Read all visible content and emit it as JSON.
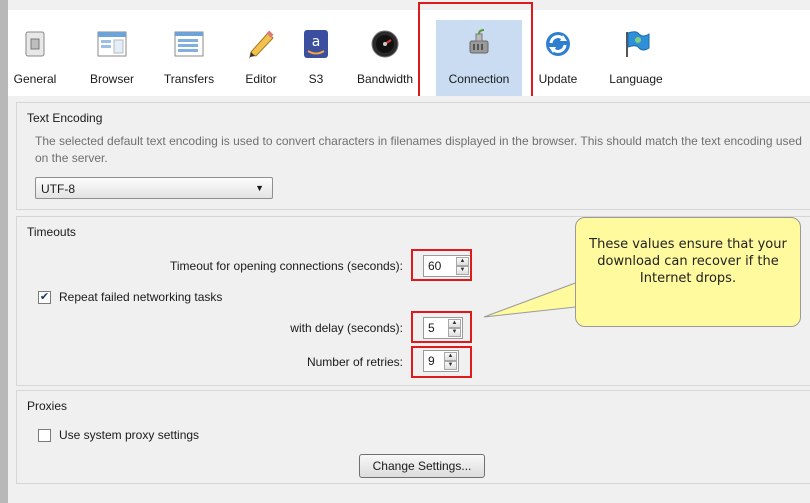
{
  "toolbar": {
    "items": [
      {
        "label": "General",
        "icon": "switch-icon"
      },
      {
        "label": "Browser",
        "icon": "browser-window-icon"
      },
      {
        "label": "Transfers",
        "icon": "transfers-list-icon"
      },
      {
        "label": "Editor",
        "icon": "pencil-icon"
      },
      {
        "label": "S3",
        "icon": "amazon-icon"
      },
      {
        "label": "Bandwidth",
        "icon": "speedometer-icon"
      },
      {
        "label": "Connection",
        "icon": "network-plug-icon"
      },
      {
        "label": "Update",
        "icon": "refresh-icon"
      },
      {
        "label": "Language",
        "icon": "flag-icon"
      }
    ],
    "active": "Connection"
  },
  "text_encoding": {
    "title": "Text Encoding",
    "description": "The selected default text encoding is used to convert characters in filenames displayed in the browser. This should match the text encoding used on the server.",
    "selected": "UTF-8"
  },
  "timeouts": {
    "title": "Timeouts",
    "timeout_label": "Timeout for opening connections (seconds):",
    "timeout_value": "60",
    "repeat_label": "Repeat failed networking tasks",
    "repeat_checked": true,
    "delay_label": "with delay (seconds):",
    "delay_value": "5",
    "retries_label": "Number of retries:",
    "retries_value": "9"
  },
  "proxies": {
    "title": "Proxies",
    "system_proxy_label": "Use system proxy settings",
    "system_proxy_checked": false,
    "change_settings_label": "Change Settings..."
  },
  "callout": {
    "text": "These values ensure that your download can recover if the Internet drops."
  },
  "colors": {
    "highlight_red": "#e0191c",
    "callout_yellow": "#fffa9e",
    "active_tab": "#c9dcf2"
  }
}
